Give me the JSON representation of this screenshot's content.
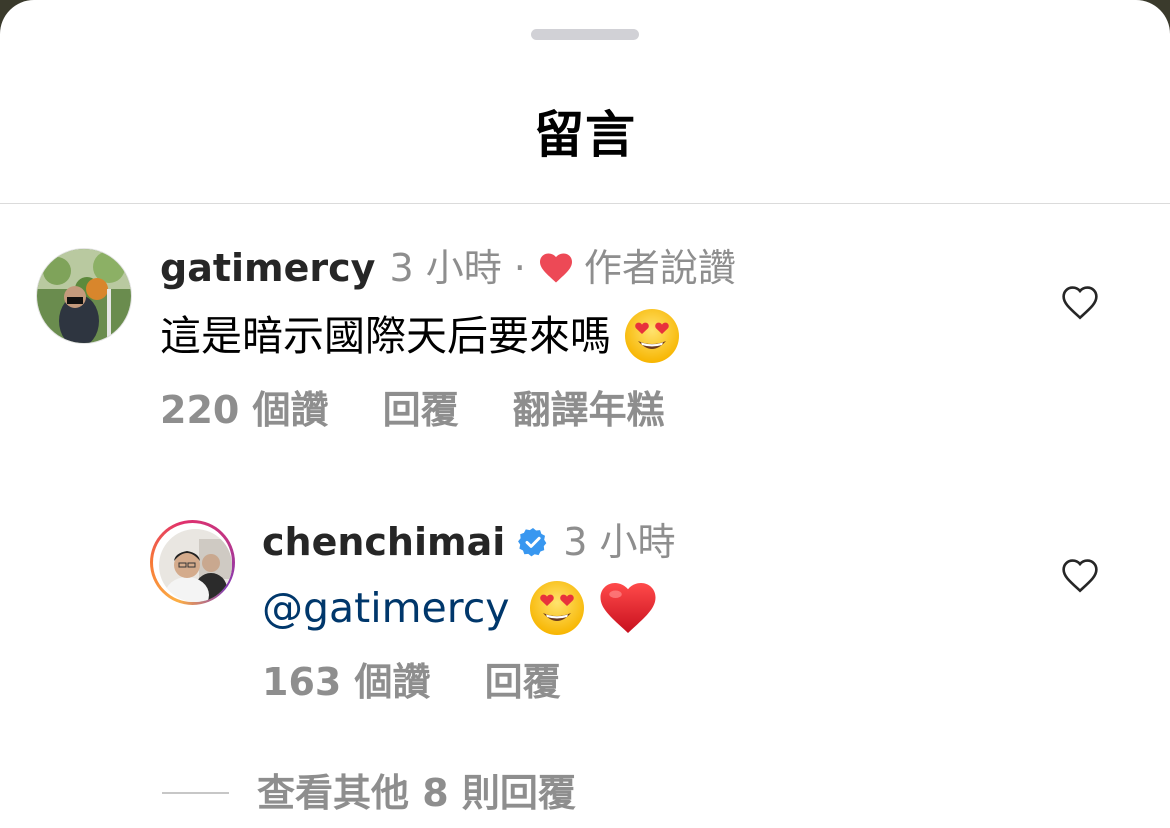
{
  "sheet": {
    "title": "留言"
  },
  "comments": [
    {
      "username": "gatimercy",
      "time": "3 小時",
      "separator": "·",
      "author_liked": "作者說讚",
      "author_heart_icon": "heart-filled-red-icon",
      "text": "這是暗示國際天后要來嗎",
      "emoji": [
        "heart-eyes-emoji"
      ],
      "likes": "220 個讚",
      "reply": "回覆",
      "translate": "翻譯年糕",
      "like_icon": "heart-outline-icon"
    }
  ],
  "replies": [
    {
      "username": "chenchimai",
      "verified_icon": "verified-badge-icon",
      "time": "3 小時",
      "mention": "@gatimercy",
      "emoji": [
        "heart-eyes-emoji",
        "red-heart-emoji"
      ],
      "likes": "163 個讚",
      "reply": "回覆",
      "like_icon": "heart-outline-icon"
    }
  ],
  "more_replies": "查看其他 8 則回覆",
  "colors": {
    "heart_red": "#ed4956",
    "verified_blue": "#3897f0",
    "mention": "#00376b",
    "secondary_text": "#8e8e8e"
  }
}
